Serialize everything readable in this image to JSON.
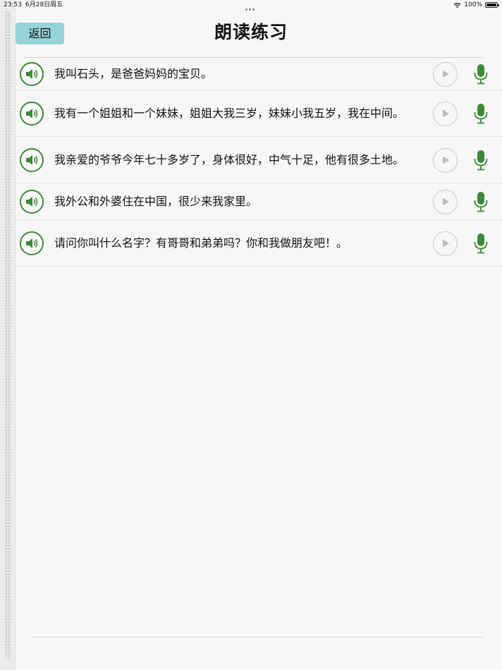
{
  "status_bar": {
    "time": "23:53",
    "date": "6月28日周五",
    "battery": "100%"
  },
  "header": {
    "back_label": "返回",
    "title": "朗读练习"
  },
  "sentences": [
    {
      "text": "我叫石头，是爸爸妈妈的宝贝。"
    },
    {
      "text": "我有一个姐姐和一个妹妹，姐姐大我三岁，妹妹小我五岁，我在中间。"
    },
    {
      "text": "我亲爱的爷爷今年七十多岁了，身体很好，中气十足，他有很多土地。"
    },
    {
      "text": "我外公和外婆住在中国，很少来我家里。"
    },
    {
      "text": "请问你叫什么名字？有哥哥和弟弟吗？你和我做朋友吧！。"
    }
  ],
  "icons": {
    "speaker": "speaker-icon",
    "play": "play-icon",
    "mic": "microphone-icon"
  },
  "colors": {
    "accent_green": "#3c8a37",
    "back_button": "#97d4d8",
    "play_gray": "#c9c9c9"
  }
}
